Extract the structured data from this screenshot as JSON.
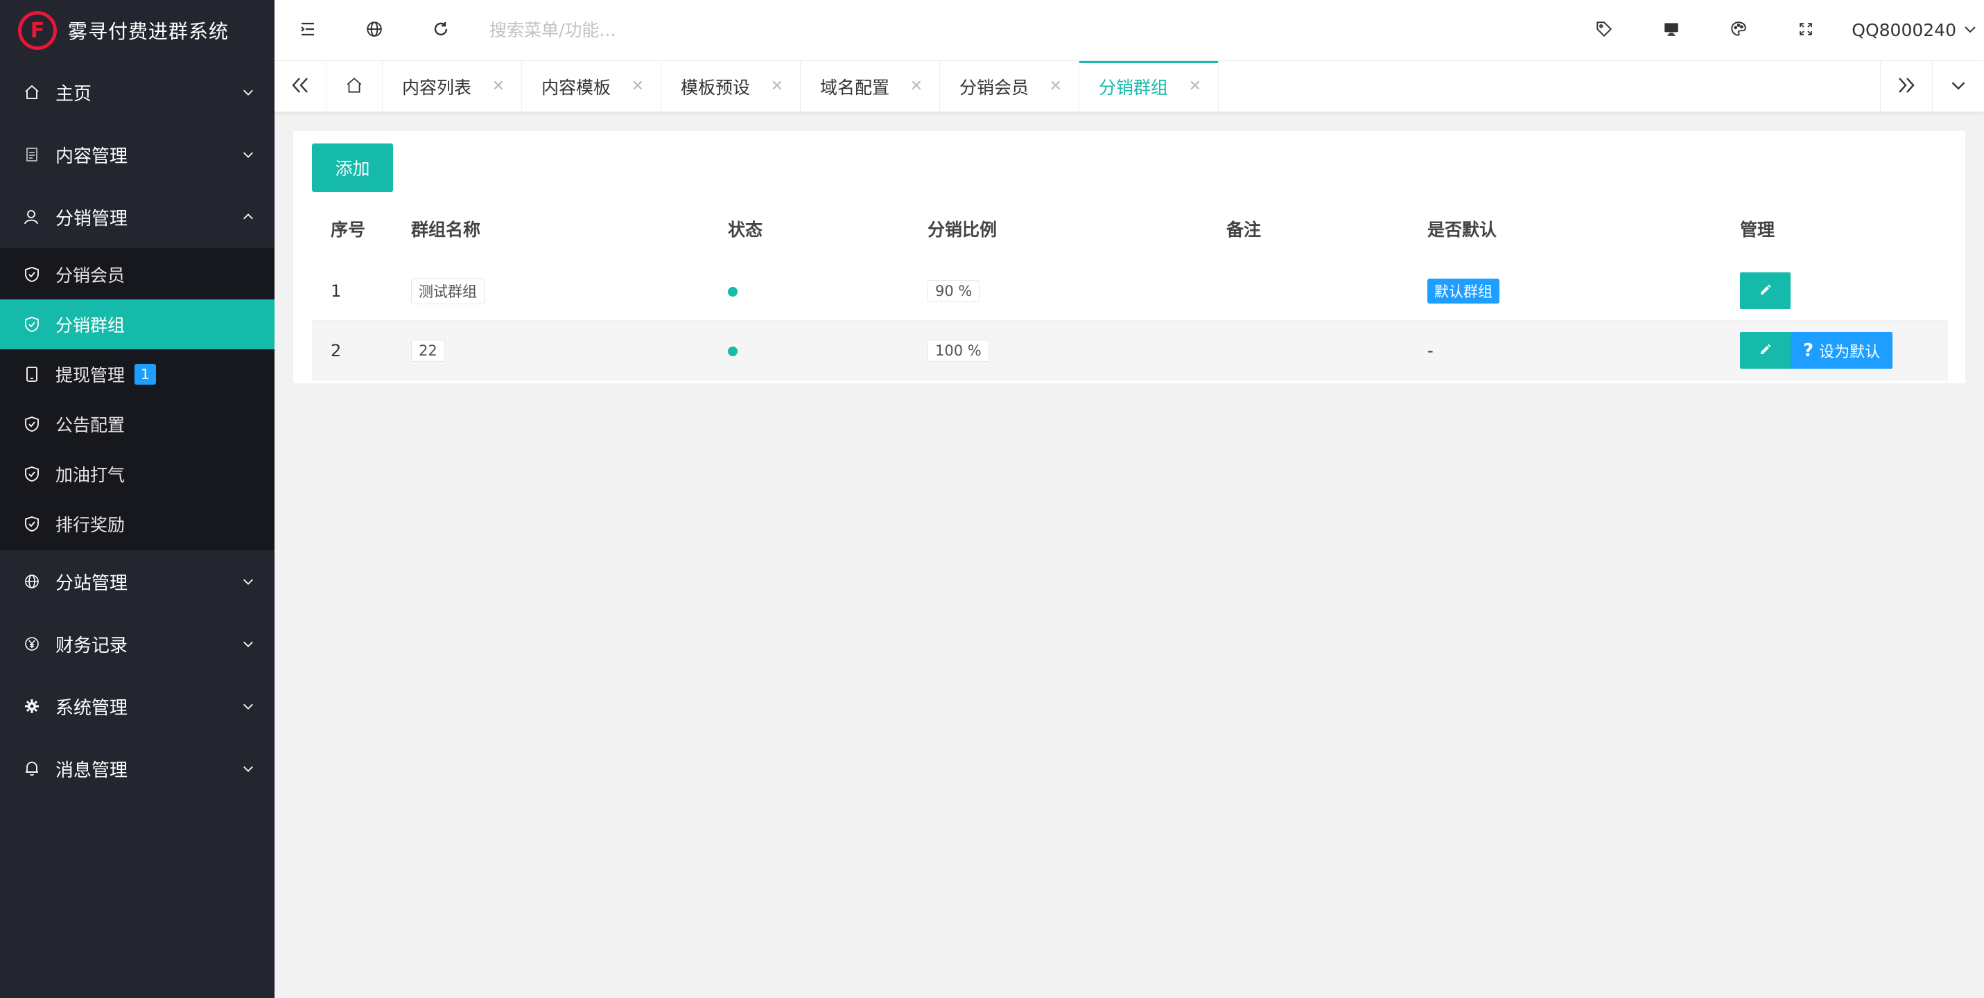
{
  "app": {
    "title": "雾寻付费进群系统"
  },
  "colors": {
    "accent": "#16baaa",
    "sidebar_bg": "#23262e",
    "info_blue": "#1e9fff",
    "logo_red": "#e8163a"
  },
  "sidebar": {
    "items": [
      {
        "label": "主页",
        "icon": "home-icon",
        "expanded": false
      },
      {
        "label": "内容管理",
        "icon": "document-icon",
        "expanded": false
      },
      {
        "label": "分销管理",
        "icon": "user-icon",
        "expanded": true,
        "children": [
          {
            "label": "分销会员",
            "icon": "shield-icon"
          },
          {
            "label": "分销群组",
            "icon": "shield-icon",
            "active": true
          },
          {
            "label": "提现管理",
            "icon": "tablet-icon",
            "badge": "1"
          },
          {
            "label": "公告配置",
            "icon": "shield-icon"
          },
          {
            "label": "加油打气",
            "icon": "shield-icon"
          },
          {
            "label": "排行奖励",
            "icon": "shield-icon"
          }
        ]
      },
      {
        "label": "分站管理",
        "icon": "globe-icon",
        "expanded": false
      },
      {
        "label": "财务记录",
        "icon": "yen-icon",
        "expanded": false
      },
      {
        "label": "系统管理",
        "icon": "gear-icon",
        "expanded": false
      },
      {
        "label": "消息管理",
        "icon": "bell-icon",
        "expanded": false
      }
    ]
  },
  "header": {
    "search_placeholder": "搜索菜单/功能...",
    "user": "QQ8000240"
  },
  "tabs": [
    {
      "label": "内容列表"
    },
    {
      "label": "内容模板"
    },
    {
      "label": "模板预设"
    },
    {
      "label": "域名配置"
    },
    {
      "label": "分销会员"
    },
    {
      "label": "分销群组",
      "active": true
    }
  ],
  "content": {
    "add_label": "添加",
    "columns": [
      "序号",
      "群组名称",
      "状态",
      "分销比例",
      "备注",
      "是否默认",
      "管理"
    ],
    "rows": [
      {
        "index": "1",
        "name": "测试群组",
        "status": "enabled",
        "ratio": "90 %",
        "note": "",
        "default": "默认群组",
        "is_default": true
      },
      {
        "index": "2",
        "name": "22",
        "status": "enabled",
        "ratio": "100 %",
        "note": "",
        "default": "-",
        "is_default": false
      }
    ],
    "set_default_label": "设为默认"
  }
}
